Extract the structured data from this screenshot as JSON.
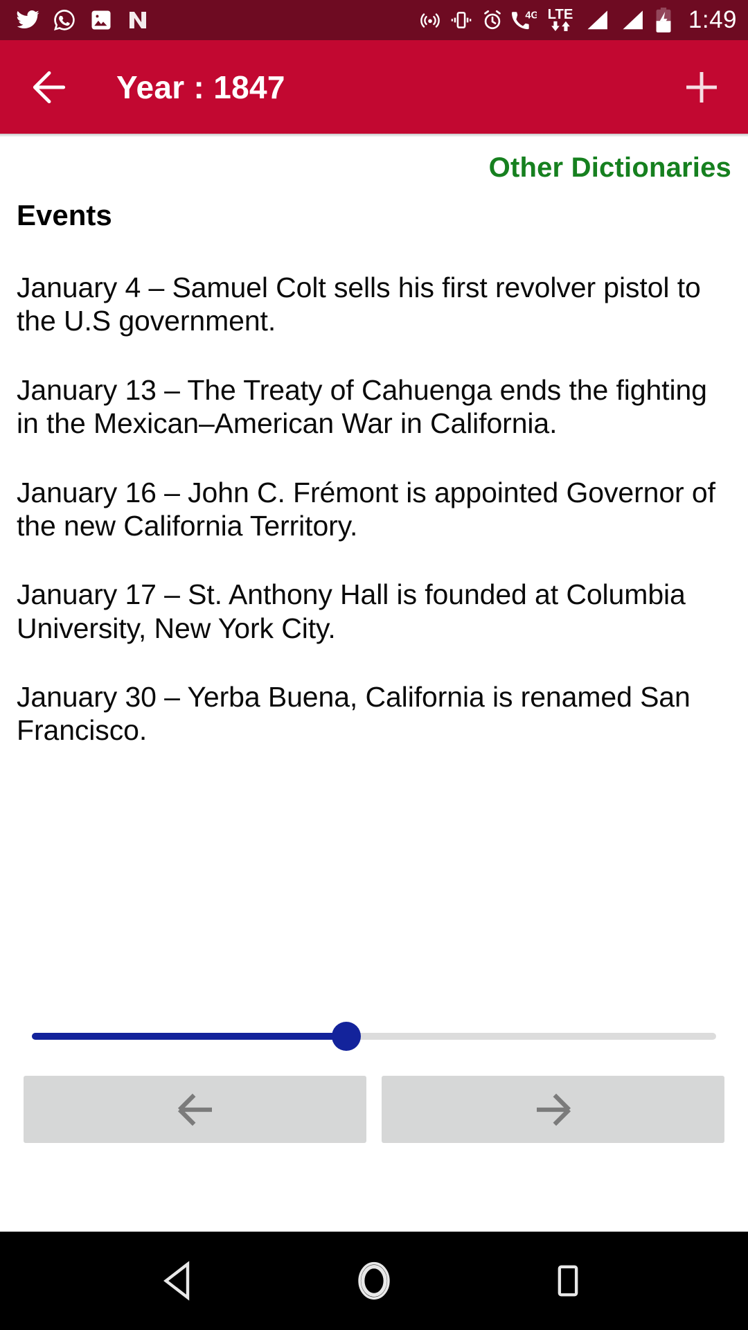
{
  "status_bar": {
    "background_color": "#6e0b22",
    "clock": "1:49",
    "left_icons": [
      "twitter-icon",
      "whatsapp-icon",
      "gallery-icon",
      "nova-launcher-icon"
    ],
    "right_icons": [
      "hotspot-icon",
      "vibrate-icon",
      "alarm-icon",
      "4g-call-icon",
      "lte-data-icon",
      "signal-sim1-icon",
      "signal-sim2-icon",
      "battery-charging-icon"
    ],
    "network_label_4g": "4G",
    "network_label_lte": "LTE",
    "battery_level_percent": 50,
    "battery_charging": true
  },
  "app_bar": {
    "background_color": "#c20831",
    "title": "Year : 1847",
    "back_icon": "arrow-left-icon",
    "add_icon": "plus-icon"
  },
  "content": {
    "other_dictionaries_label": "Other Dictionaries",
    "other_dictionaries_color": "#16801f",
    "section_title": "Events",
    "events": [
      "January 4 – Samuel Colt sells his first revolver pistol to the U.S government.",
      "January 13 – The Treaty of Cahuenga ends the fighting in the Mexican–American War in California.",
      "January 16 – John C. Frémont is appointed Governor of the new California Territory.",
      "January 17 – St. Anthony Hall is founded at Columbia University, New York City.",
      "January 30 – Yerba Buena, California is renamed San Francisco."
    ]
  },
  "slider": {
    "value_percent": 46,
    "fill_color": "#13239b",
    "track_color": "#dcdcdc"
  },
  "nav_buttons": {
    "previous_icon": "arrow-left-icon",
    "next_icon": "arrow-right-icon",
    "background_color": "#d6d7d7"
  },
  "system_nav": {
    "background_color": "#000000",
    "back_icon": "triangle-back-icon",
    "home_icon": "circle-home-icon",
    "recents_icon": "square-recents-icon"
  }
}
